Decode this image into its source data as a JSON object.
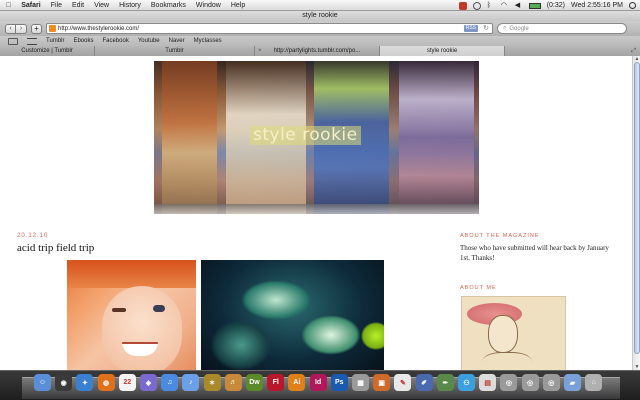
{
  "menubar": {
    "apple": "",
    "items": [
      "Safari",
      "File",
      "Edit",
      "View",
      "History",
      "Bookmarks",
      "Window",
      "Help"
    ],
    "battery": "(0:32)",
    "clock": "Wed 2:55:16 PM"
  },
  "window": {
    "title": "style rookie"
  },
  "toolbar": {
    "back": "‹",
    "forward": "›",
    "add": "+",
    "url": "http://www.thestylerookie.com/",
    "rss": "RSS",
    "reload": "↻",
    "search_placeholder": "Google"
  },
  "bookmarks": {
    "items": [
      "Tumblr",
      "Ebooks",
      "Facebook",
      "Youtube",
      "Naver",
      "Myclasses"
    ]
  },
  "tabs": [
    {
      "label": "Customize | Tumblr"
    },
    {
      "label": "Tumblr"
    },
    {
      "label": "http://partylights.tumblr.com/po..."
    },
    {
      "label": "style rookie"
    }
  ],
  "page": {
    "logo_text": "style rookie",
    "post": {
      "date": "20.12.10",
      "title": "acid trip field trip"
    },
    "sidebar": {
      "magazine_heading": "ABOUT THE MAGAZINE",
      "magazine_text": "Those who have submitted will hear back by January 1st. Thanks!",
      "about_heading": "ABOUT ME"
    }
  },
  "dock": {
    "apps": [
      {
        "name": "finder",
        "color": "#5a8fd8",
        "glyph": "☺"
      },
      {
        "name": "dashboard",
        "color": "#3a3a3a",
        "glyph": "◉"
      },
      {
        "name": "safari",
        "color": "#3a7fd0",
        "glyph": "✦"
      },
      {
        "name": "firefox",
        "color": "#e0701a",
        "glyph": "◍"
      },
      {
        "name": "ical",
        "color": "#f4f4f4",
        "glyph": "22"
      },
      {
        "name": "photo-booth",
        "color": "#7a6ad0",
        "glyph": "◈"
      },
      {
        "name": "itunes",
        "color": "#4a8ae0",
        "glyph": "♫"
      },
      {
        "name": "itunes-2",
        "color": "#6aa0e8",
        "glyph": "♪"
      },
      {
        "name": "spaces",
        "color": "#a88a2a",
        "glyph": "✶"
      },
      {
        "name": "garageband",
        "color": "#c88a3a",
        "glyph": "♬"
      },
      {
        "name": "dreamweaver",
        "color": "#5a8a2a",
        "glyph": "Dw"
      },
      {
        "name": "flash",
        "color": "#b8182a",
        "glyph": "Fl"
      },
      {
        "name": "illustrator",
        "color": "#e0801a",
        "glyph": "Ai"
      },
      {
        "name": "indesign",
        "color": "#b0185a",
        "glyph": "Id"
      },
      {
        "name": "photoshop",
        "color": "#1a5ab0",
        "glyph": "Ps"
      },
      {
        "name": "calculator",
        "color": "#9a9a9a",
        "glyph": "▦"
      },
      {
        "name": "preview",
        "color": "#d06a2a",
        "glyph": "▣"
      },
      {
        "name": "textedit",
        "color": "#e8e8e8",
        "glyph": "✎"
      },
      {
        "name": "pencil",
        "color": "#4a6ab0",
        "glyph": "✐"
      },
      {
        "name": "brush",
        "color": "#5a8a4a",
        "glyph": "✒"
      },
      {
        "name": "messenger",
        "color": "#3aa0e0",
        "glyph": "⚇"
      },
      {
        "name": "document",
        "color": "#dcdcdc",
        "glyph": "▤"
      },
      {
        "name": "stack-1",
        "color": "#9a9a9a",
        "glyph": "◎"
      },
      {
        "name": "stack-2",
        "color": "#9a9a9a",
        "glyph": "◎"
      },
      {
        "name": "stack-3",
        "color": "#9a9a9a",
        "glyph": "◎"
      },
      {
        "name": "downloads-folder",
        "color": "#7aa0d8",
        "glyph": "▰"
      },
      {
        "name": "trash",
        "color": "#b0b0b0",
        "glyph": "⌂"
      }
    ]
  }
}
